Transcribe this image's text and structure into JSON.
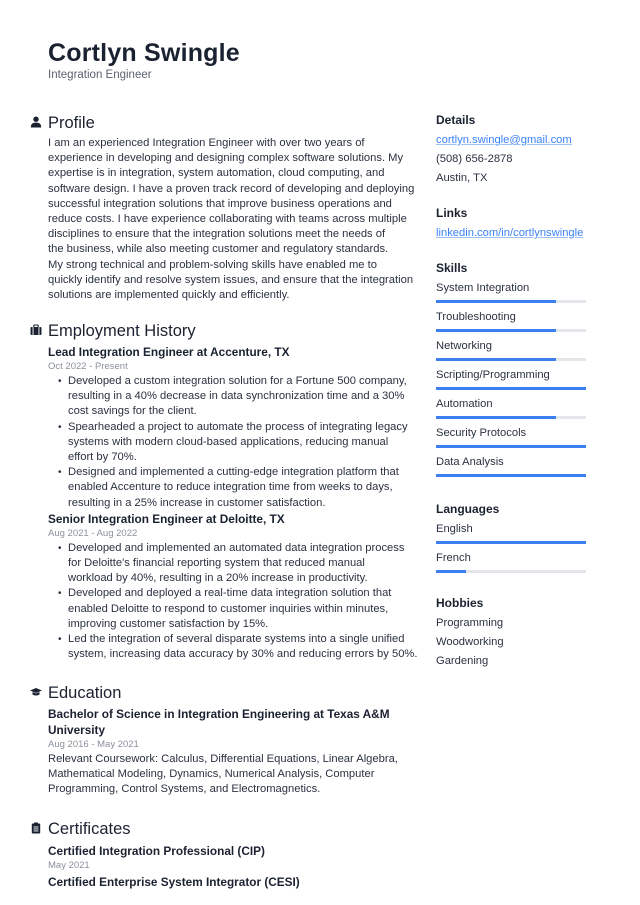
{
  "header": {
    "name": "Cortlyn Swingle",
    "title": "Integration Engineer"
  },
  "profile": {
    "heading": "Profile",
    "icon": "person-icon",
    "lines": [
      "I am an experienced Integration Engineer with over two years of",
      "experience in developing and designing complex software solutions. My",
      "expertise is in integration, system automation, cloud computing, and",
      "software design. I have a proven track record of developing and deploying",
      "successful integration solutions that improve business operations and",
      "reduce costs. I have experience collaborating with teams across multiple",
      "disciplines to ensure that the integration solutions meet the needs of",
      "the business, while also meeting customer and regulatory standards.",
      "My strong technical and problem-solving skills have enabled me to",
      "quickly identify and resolve system issues, and ensure that the integration",
      "solutions are implemented quickly and efficiently."
    ]
  },
  "employment": {
    "heading": "Employment History",
    "icon": "briefcase-icon",
    "jobs": [
      {
        "title": "Lead Integration Engineer at Accenture, TX",
        "date": "Oct 2022 - Present",
        "bullets": [
          [
            "Developed a custom integration solution for a Fortune 500 company,",
            "resulting in a 40% decrease in data synchronization time and a 30%",
            "cost savings for the client."
          ],
          [
            "Spearheaded a project to automate the process of integrating legacy",
            "systems with modern cloud-based applications, reducing manual",
            "effort by 70%."
          ],
          [
            "Designed and implemented a cutting-edge integration platform that",
            "enabled Accenture to reduce integration time from weeks to days,",
            "resulting in a 25% increase in customer satisfaction."
          ]
        ]
      },
      {
        "title": "Senior Integration Engineer at Deloitte, TX",
        "date": "Aug 2021 - Aug 2022",
        "bullets": [
          [
            "Developed and implemented an automated data integration process",
            "for Deloitte's financial reporting system that reduced manual",
            "workload by 40%, resulting in a 20% increase in productivity."
          ],
          [
            "Developed and deployed a real-time data integration solution that",
            "enabled Deloitte to respond to customer inquiries within minutes,",
            "improving customer satisfaction by 15%."
          ],
          [
            "Led the integration of several disparate systems into a single unified",
            "system, increasing data accuracy by 30% and reducing errors by 50%."
          ]
        ]
      }
    ]
  },
  "education": {
    "heading": "Education",
    "icon": "graduation-cap-icon",
    "items": [
      {
        "title_lines": [
          "Bachelor of Science in Integration Engineering at Texas A&M",
          "University"
        ],
        "date": "Aug 2016 - May 2021",
        "desc_lines": [
          "Relevant Coursework: Calculus, Differential Equations, Linear Algebra,",
          "Mathematical Modeling, Dynamics, Numerical Analysis, Computer",
          "Programming, Control Systems, and Electromagnetics."
        ]
      }
    ]
  },
  "certificates": {
    "heading": "Certificates",
    "icon": "clipboard-icon",
    "items": [
      {
        "title": "Certified Integration Professional (CIP)",
        "date": "May 2021"
      },
      {
        "title": "Certified Enterprise System Integrator (CESI)",
        "date": ""
      }
    ]
  },
  "details": {
    "heading": "Details",
    "email": "cortlyn.swingle@gmail.com",
    "phone": "(508) 656-2878",
    "location": "Austin, TX"
  },
  "links": {
    "heading": "Links",
    "items": [
      "linkedin.com/in/cortlynswingle"
    ]
  },
  "skills": {
    "heading": "Skills",
    "items": [
      {
        "name": "System Integration",
        "level": 0.8
      },
      {
        "name": "Troubleshooting",
        "level": 0.8
      },
      {
        "name": "Networking",
        "level": 0.8
      },
      {
        "name": "Scripting/Programming",
        "level": 1.0
      },
      {
        "name": "Automation",
        "level": 0.8
      },
      {
        "name": "Security Protocols",
        "level": 1.0
      },
      {
        "name": "Data Analysis",
        "level": 1.0
      }
    ]
  },
  "languages": {
    "heading": "Languages",
    "items": [
      {
        "name": "English",
        "level": 1.0
      },
      {
        "name": "French",
        "level": 0.2
      }
    ]
  },
  "hobbies": {
    "heading": "Hobbies",
    "items": [
      "Programming",
      "Woodworking",
      "Gardening"
    ]
  },
  "colors": {
    "accent": "#3b7ff0",
    "text": "#1a2130",
    "muted": "#8a919c",
    "track": "#e4e6ea"
  }
}
